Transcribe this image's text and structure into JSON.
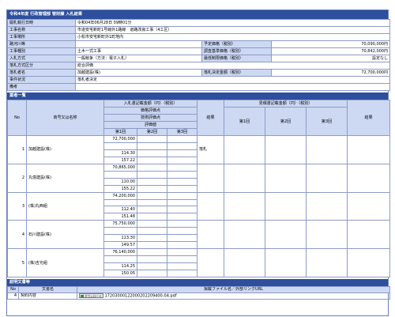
{
  "header": {
    "title": "令和4年度 行政管理部 管財課 入札結果"
  },
  "info": {
    "rows": [
      {
        "label": "開札執行日時",
        "value": "令和04年06月28日 09時01分"
      },
      {
        "label": "工事名称",
        "value": "市道安宅新町1号線外1路線　道路改良工事（4工区）"
      },
      {
        "label": "工事場所",
        "value": "小松市安宅新町外1町地内"
      }
    ],
    "pair_rows": [
      {
        "label": "路河川等",
        "value": "",
        "label2": "予定価格（税別）",
        "value2": "70,090,000円"
      },
      {
        "label": "工事種別",
        "value": "土木一式工事",
        "label2": "調査基準価格（税別）",
        "value2": "70,842,000円"
      },
      {
        "label": "入札方式",
        "value": "一般競争（方法：電子入札）",
        "label2": "最低制限価格（税別）",
        "value2": "設定なし"
      }
    ],
    "method_label": "落札方式区分",
    "method_value": "総合評価",
    "winner_label": "落札者名",
    "winner_value": "加越建設(株)",
    "winner_amount_label": "落札決定金額（税別）",
    "winner_amount": "72,700,000円",
    "progress_label": "事件状況",
    "progress_value": "落札者決定",
    "remarks_label": "備考",
    "remarks_value": ""
  },
  "bids": {
    "section_title": "業者一覧",
    "col_no": "No",
    "col_name": "商号又は名称",
    "col_bid_header": "入札書記載金額（円）（税別）",
    "sub_price_score": "価格評価点",
    "sub_tech_score": "技術評価点",
    "sub_eval": "評価値",
    "round1": "第1回",
    "round2": "第2回",
    "round3": "第3回",
    "col_result": "結果",
    "col_negotiation": "見積書記載金額（円）（税別）",
    "col_result2": "結果",
    "rows": [
      {
        "no": "1",
        "name": "加越建設(株)",
        "amount": "72,700,000",
        "price_score": "",
        "tech_score": "114.30",
        "eval": "157.22",
        "result": "落札"
      },
      {
        "no": "2",
        "name": "丸億建設(株)",
        "amount": "70,865,000",
        "price_score": "",
        "tech_score": "110.00",
        "eval": "155.22",
        "result": ""
      },
      {
        "no": "3",
        "name": "(株)丸西組",
        "amount": "74,200,000",
        "price_score": "",
        "tech_score": "112.40",
        "eval": "151.48",
        "result": ""
      },
      {
        "no": "4",
        "name": "石川建設(株)",
        "amount": "75,750,000",
        "price_score": "",
        "tech_score": "113.30",
        "eval": "149.57",
        "result": ""
      },
      {
        "no": "5",
        "name": "(株)吉光組",
        "amount": "76,140,000",
        "price_score": "",
        "tech_score": "114.25",
        "eval": "150.05",
        "result": ""
      }
    ]
  },
  "docs": {
    "section_title": "説明文書等",
    "col_no": "No",
    "col_name": "文書名",
    "col_file": "掲載ファイル名／外部リンクURL",
    "rows": [
      {
        "no": "4",
        "name": "契約内容",
        "button": "ダウンロード",
        "file": "17203000122000202209400-04.pdf"
      }
    ]
  }
}
